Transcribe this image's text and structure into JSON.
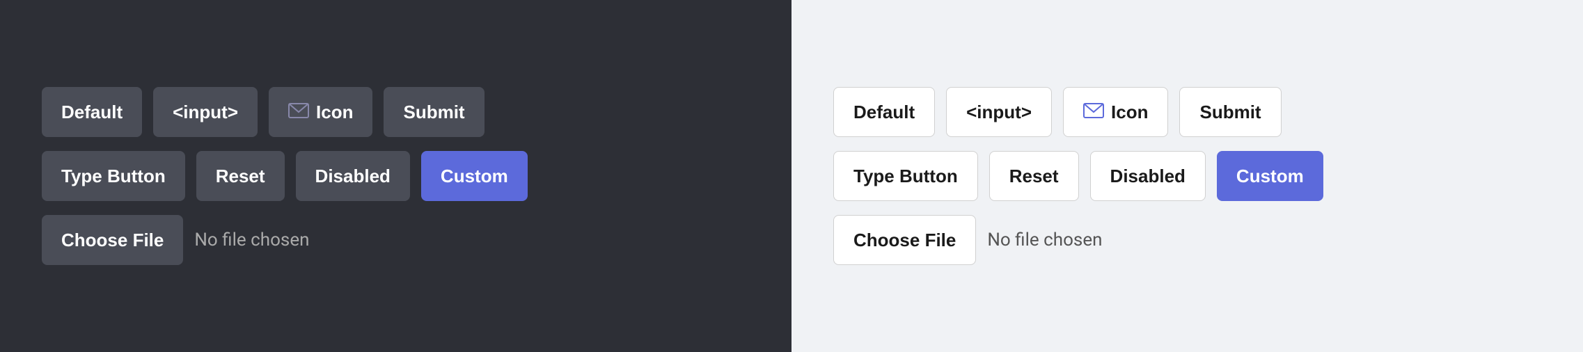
{
  "panels": {
    "dark": {
      "background": "#2d2f36",
      "row1": {
        "buttons": [
          {
            "id": "default",
            "label": "Default",
            "type": "regular"
          },
          {
            "id": "input",
            "label": "<input>",
            "type": "regular"
          },
          {
            "id": "icon",
            "label": "Icon",
            "type": "icon"
          },
          {
            "id": "submit",
            "label": "Submit",
            "type": "regular"
          }
        ]
      },
      "row2": {
        "buttons": [
          {
            "id": "type-button",
            "label": "Type Button",
            "type": "regular"
          },
          {
            "id": "reset",
            "label": "Reset",
            "type": "regular"
          },
          {
            "id": "disabled",
            "label": "Disabled",
            "type": "regular"
          },
          {
            "id": "custom",
            "label": "Custom",
            "type": "custom"
          }
        ]
      },
      "file": {
        "choose_label": "Choose File",
        "no_file_text": "No file chosen"
      }
    },
    "light": {
      "background": "#f0f2f5",
      "row1": {
        "buttons": [
          {
            "id": "default",
            "label": "Default",
            "type": "regular"
          },
          {
            "id": "input",
            "label": "<input>",
            "type": "regular"
          },
          {
            "id": "icon",
            "label": "Icon",
            "type": "icon"
          },
          {
            "id": "submit",
            "label": "Submit",
            "type": "regular"
          }
        ]
      },
      "row2": {
        "buttons": [
          {
            "id": "type-button",
            "label": "Type Button",
            "type": "regular"
          },
          {
            "id": "reset",
            "label": "Reset",
            "type": "regular"
          },
          {
            "id": "disabled",
            "label": "Disabled",
            "type": "regular"
          },
          {
            "id": "custom",
            "label": "Custom",
            "type": "custom"
          }
        ]
      },
      "file": {
        "choose_label": "Choose File",
        "no_file_text": "No file chosen"
      }
    }
  }
}
